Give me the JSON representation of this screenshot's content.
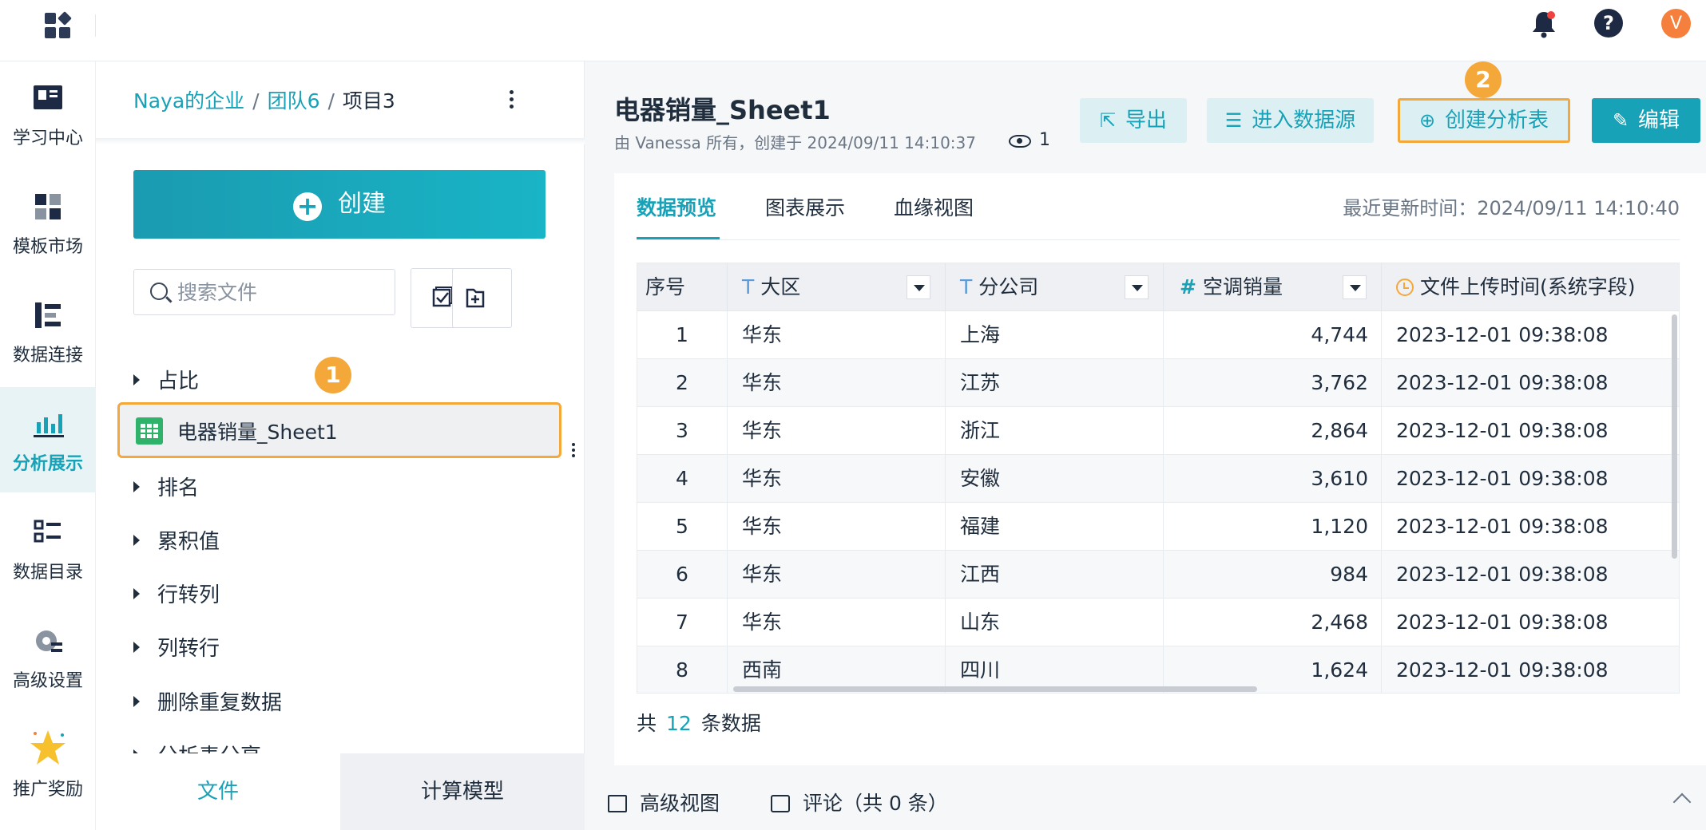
{
  "topbar": {
    "avatar_letter": "V"
  },
  "rail": {
    "items": [
      {
        "label": "学习中心",
        "icon": "book-icon"
      },
      {
        "label": "模板市场",
        "icon": "template-icon"
      },
      {
        "label": "数据连接",
        "icon": "data-connect-icon"
      },
      {
        "label": "分析展示",
        "icon": "chart-icon"
      },
      {
        "label": "数据目录",
        "icon": "catalog-icon"
      },
      {
        "label": "高级设置",
        "icon": "gear-icon"
      },
      {
        "label": "推广奖励",
        "icon": "star-icon"
      }
    ],
    "active_index": 3
  },
  "filepanel": {
    "breadcrumb": {
      "org": "Naya的企业",
      "team": "团队6",
      "project": "项目3",
      "sep": "/"
    },
    "create_label": "创建",
    "search_placeholder": "搜索文件",
    "tree": {
      "item0": "占比",
      "selected": "电器销量_Sheet1",
      "item1": "排名",
      "item2": "累积值",
      "item3": "行转列",
      "item4": "列转行",
      "item5": "删除重复数据",
      "item6": "分析表分享"
    },
    "badge1": "1",
    "tabs": {
      "files": "文件",
      "models": "计算模型"
    }
  },
  "main": {
    "title": "电器销量_Sheet1",
    "meta": "由 Vanessa 所有，创建于 2024/09/11 14:10:37",
    "views": "1",
    "badge2": "2",
    "actions": {
      "export": "导出",
      "datasource": "进入数据源",
      "create_table": "创建分析表",
      "edit": "编辑"
    },
    "tabs": {
      "preview": "数据预览",
      "chart": "图表展示",
      "lineage": "血缘视图"
    },
    "updated": "最近更新时间：2024/09/11 14:10:40",
    "columns": {
      "index": "序号",
      "region": "大区",
      "company": "分公司",
      "ac_sales": "空调销量",
      "upload_time": "文件上传时间(系统字段)"
    },
    "rows": [
      {
        "idx": "1",
        "region": "华东",
        "company": "上海",
        "sales": "4,744",
        "time": "2023-12-01 09:38:08"
      },
      {
        "idx": "2",
        "region": "华东",
        "company": "江苏",
        "sales": "3,762",
        "time": "2023-12-01 09:38:08"
      },
      {
        "idx": "3",
        "region": "华东",
        "company": "浙江",
        "sales": "2,864",
        "time": "2023-12-01 09:38:08"
      },
      {
        "idx": "4",
        "region": "华东",
        "company": "安徽",
        "sales": "3,610",
        "time": "2023-12-01 09:38:08"
      },
      {
        "idx": "5",
        "region": "华东",
        "company": "福建",
        "sales": "1,120",
        "time": "2023-12-01 09:38:08"
      },
      {
        "idx": "6",
        "region": "华东",
        "company": "江西",
        "sales": "984",
        "time": "2023-12-01 09:38:08"
      },
      {
        "idx": "7",
        "region": "华东",
        "company": "山东",
        "sales": "2,468",
        "time": "2023-12-01 09:38:08"
      },
      {
        "idx": "8",
        "region": "西南",
        "company": "四川",
        "sales": "1,624",
        "time": "2023-12-01 09:38:08"
      }
    ],
    "count": {
      "prefix": "共",
      "num": "12",
      "suffix": "条数据"
    },
    "footer": {
      "advanced": "高级视图",
      "comments": "评论（共 0 条）"
    }
  }
}
